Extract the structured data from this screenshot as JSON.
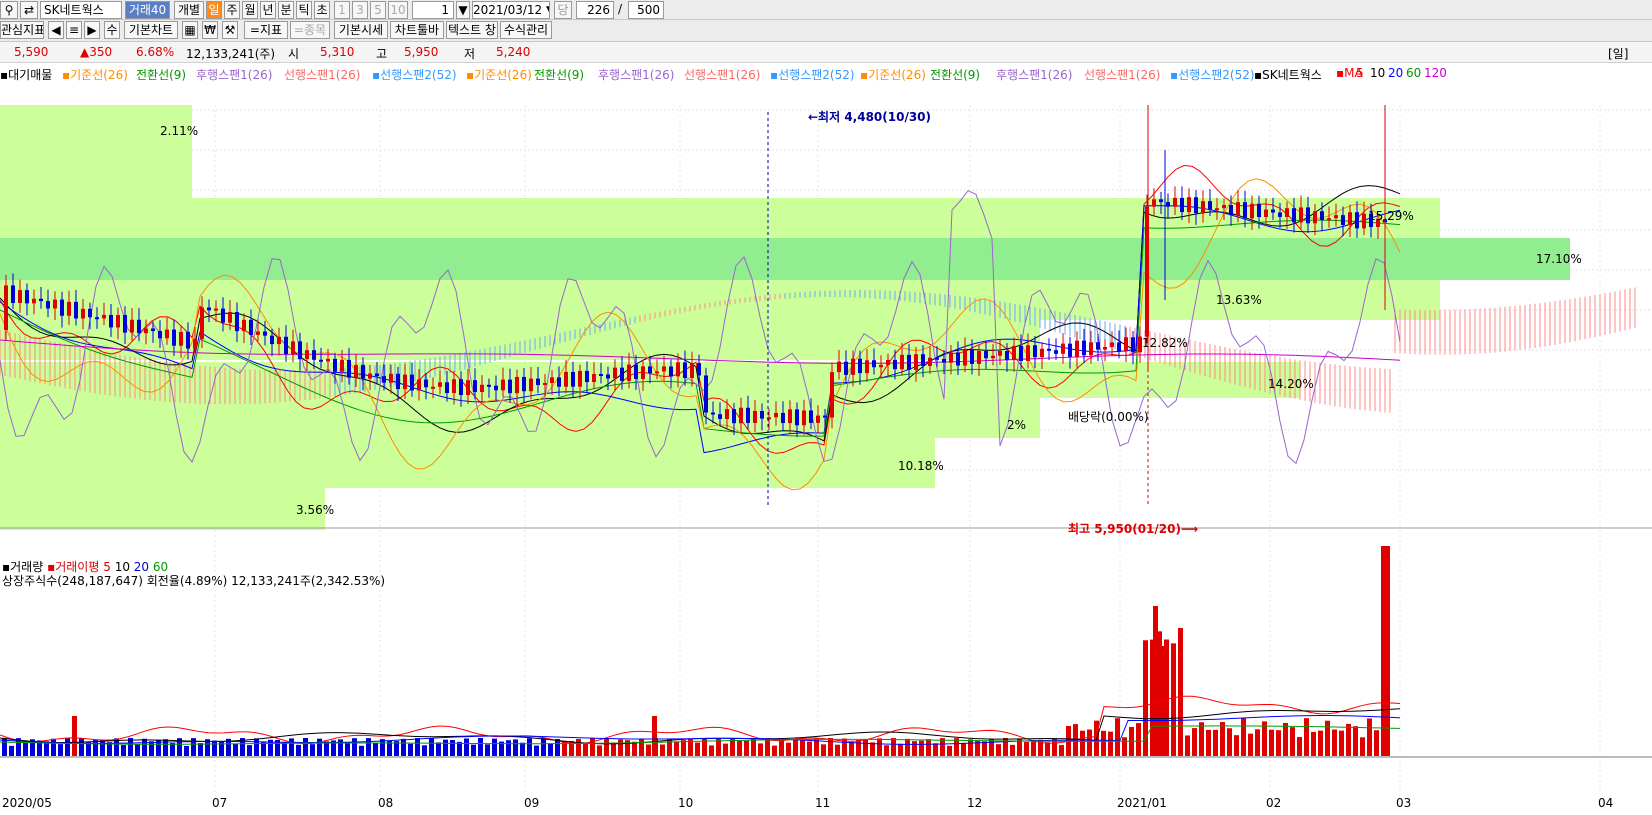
{
  "toolbar": {
    "stock_name": "SK네트웍스",
    "volume_badge": "거래40",
    "individual": "개별",
    "periods": [
      "일",
      "주",
      "월",
      "년",
      "분",
      "틱",
      "초"
    ],
    "interval_values": [
      "1",
      "3",
      "5",
      "10"
    ],
    "interval_count": "1",
    "date": "2021/03/12",
    "dang_label": "당",
    "count": "226",
    "slash": "/",
    "total": "500"
  },
  "toolbar2": {
    "interest": "관심지표",
    "basic_chart": "기본차트",
    "su": "수",
    "indicator": "=지표",
    "item": "=종목",
    "basic_quote": "기본시세",
    "chart_toolbar": "차트툴바",
    "text_label": "텍스트 창",
    "formula": "수식관리",
    "won_icon": "₩"
  },
  "price": {
    "current": "5,590",
    "change": "▲350",
    "rate": "6.68%",
    "volume": "12,133,241(주)",
    "open_label": "시",
    "open": "5,310",
    "high_label": "고",
    "high": "5,950",
    "low_label": "저",
    "low": "5,240",
    "period_badge": "[일]"
  },
  "legend": [
    {
      "text": "▪대기매물",
      "color": "#000000"
    },
    {
      "text": "▪기준선(26)",
      "color": "#ff8c00"
    },
    {
      "text": "전환선(9)",
      "color": "#009900"
    },
    {
      "text": "후행스팬1(26)",
      "color": "#9966cc"
    },
    {
      "text": "선행스팬1(26)",
      "color": "#ff6666"
    },
    {
      "text": "▪선행스팬2(52)",
      "color": "#3399ff"
    },
    {
      "text": "▪기준선(26)",
      "color": "#ff8c00"
    },
    {
      "text": "전환선(9)",
      "color": "#009900"
    },
    {
      "text": "후행스팬1(26)",
      "color": "#9966cc"
    },
    {
      "text": "선행스팬1(26)",
      "color": "#ff6666"
    },
    {
      "text": "▪선행스팬2(52)",
      "color": "#3399ff"
    },
    {
      "text": "▪기준선(26)",
      "color": "#ff8c00"
    },
    {
      "text": "전환선(9)",
      "color": "#009900"
    },
    {
      "text": "후행스팬1(26)",
      "color": "#9966cc"
    },
    {
      "text": "선행스팬1(26)",
      "color": "#ff6666"
    },
    {
      "text": "▪선행스팬2(52)",
      "color": "#3399ff"
    },
    {
      "text": "▪SK네트웍스",
      "color": "#000000"
    },
    {
      "text": "▪MA",
      "color": "#ff0000"
    },
    {
      "text": "5",
      "color": "#ff0000"
    },
    {
      "text": "10",
      "color": "#000000"
    },
    {
      "text": "20",
      "color": "#0000ff"
    },
    {
      "text": "60",
      "color": "#009900"
    },
    {
      "text": "120",
      "color": "#cc00cc"
    }
  ],
  "annotations": {
    "low_marker": "←최저 4,480(10/30)",
    "high_marker": "최고 5,950(01/20)⟶",
    "dividend": "배당락(0.00%)",
    "pct_211": "2.11%",
    "pct_356": "3.56%",
    "pct_1282": "12.82%",
    "pct_1363": "13.63%",
    "pct_1420": "14.20%",
    "pct_1529": "15.29%",
    "pct_1710": "17.10%",
    "pct_108": "10.18%",
    "pct_2": "2%"
  },
  "volume_panel": {
    "title": "▪거래량",
    "ma_label": "▪거래이평",
    "ma_values": [
      "5",
      "10",
      "20",
      "60"
    ],
    "ma_colors": [
      "#ff0000",
      "#000000",
      "#0000ff",
      "#009900"
    ],
    "info": "상장주식수(248,187,647) 회전율(4.89%) 12,133,241주(2,342.53%)"
  },
  "dates": [
    "2020/05",
    "07",
    "08",
    "09",
    "10",
    "11",
    "12",
    "2021/01",
    "02",
    "03",
    "04"
  ],
  "colors": {
    "up": "#e00000",
    "down": "#0000dd",
    "band_light": "#ccff99",
    "band_dark": "#90ee90"
  }
}
